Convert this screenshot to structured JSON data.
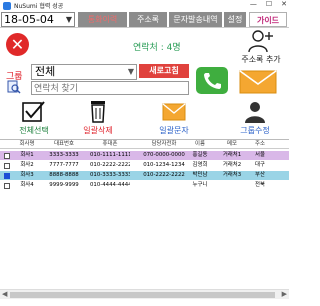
{
  "window": {
    "title": "NuSumi 협력 성공",
    "minimize": "—",
    "maximize": "☐",
    "close": "✕"
  },
  "topbar": {
    "date_value": "18-05-04",
    "tabs": [
      "통화이력",
      "주소록",
      "문자발송내역",
      "설정"
    ],
    "guide_label": "가이드"
  },
  "header": {
    "contact_count": "연락처 : 4명",
    "add_contact_label": "주소록 추가"
  },
  "filter": {
    "group_label": "그룹",
    "group_value": "전체",
    "refresh_label": "새로고침",
    "search_placeholder": "연락처 찾기"
  },
  "actions": {
    "select_all": "전체선택",
    "delete_all": "일괄삭제",
    "send_all": "일괄문자",
    "edit_group": "그룹수정"
  },
  "table": {
    "columns": [
      "회사명",
      "대표번호",
      "휴대폰",
      "담당자전화",
      "이름",
      "메모",
      "주소"
    ],
    "rows": [
      {
        "checked": false,
        "cells": [
          "회사1",
          "3333-3333",
          "010-1111-1111",
          "070-0000-0000",
          "홍길동",
          "거래처1",
          "서울"
        ],
        "bg": "#d9b8e8"
      },
      {
        "checked": false,
        "cells": [
          "회사2",
          "7777-7777",
          "010-2222-2222",
          "010-1234-1234",
          "김영희",
          "거래처2",
          "대구"
        ],
        "bg": "#ffffff"
      },
      {
        "checked": true,
        "cells": [
          "회사3",
          "8888-8888",
          "010-3333-3333",
          "010-2222-2222",
          "박민남",
          "거래처3",
          "부산"
        ],
        "bg": "#9ad4e6"
      },
      {
        "checked": false,
        "cells": [
          "회사4",
          "9999-9999",
          "010-4444-4444",
          "",
          "누구니",
          "",
          "전북"
        ],
        "bg": "#ffffff"
      }
    ]
  },
  "colors": {
    "tab_bg": "#8c8c8c",
    "accent_red": "#e0242d",
    "accent_green": "#2a9d57",
    "accent_blue": "#2a60c8"
  }
}
